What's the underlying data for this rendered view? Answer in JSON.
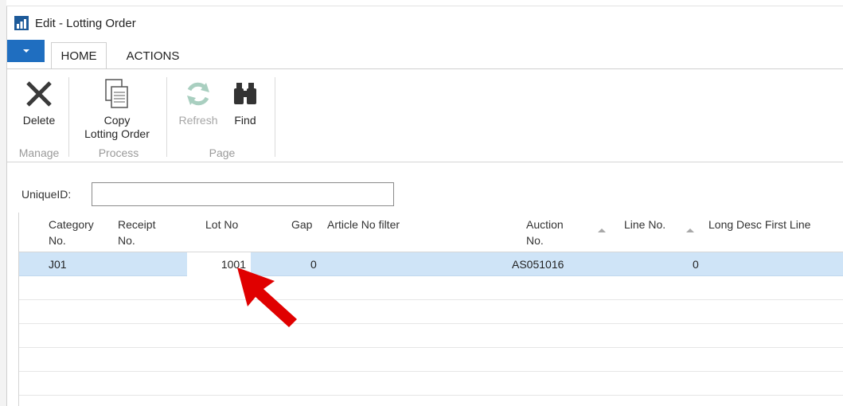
{
  "window": {
    "title": "Edit - Lotting Order"
  },
  "tabs": {
    "home": "HOME",
    "actions": "ACTIONS"
  },
  "ribbon": {
    "groups": {
      "manage": "Manage",
      "process": "Process",
      "page": "Page"
    },
    "buttons": {
      "delete": "Delete",
      "copy_line1": "Copy",
      "copy_line2": "Lotting Order",
      "refresh": "Refresh",
      "find": "Find"
    }
  },
  "filter": {
    "label": "UniqueID:",
    "value": ""
  },
  "grid": {
    "headers": {
      "category_1": "Category",
      "category_2": "No.",
      "receipt_1": "Receipt",
      "receipt_2": "No.",
      "lot_no": "Lot No",
      "gap": "Gap",
      "article": "Article No filter",
      "auction_1": "Auction",
      "auction_2": "No.",
      "line_no": "Line No.",
      "long_desc": "Long Desc First Line"
    },
    "rows": [
      {
        "category": "J01",
        "receipt": "",
        "lot_no": "1001",
        "gap": "0",
        "article": "",
        "auction": "AS051016",
        "line_no": "0",
        "long_desc": ""
      }
    ]
  },
  "colors": {
    "accent": "#1f6ec0",
    "selection": "#cfe4f7",
    "annotation_arrow": "#e00000"
  }
}
